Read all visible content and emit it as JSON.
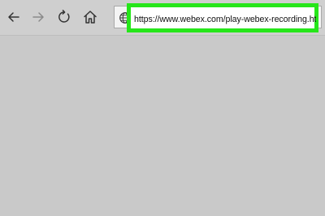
{
  "toolbar": {
    "back": {
      "icon": "back-arrow-icon",
      "enabled": true
    },
    "forward": {
      "icon": "forward-arrow-icon",
      "enabled": false
    },
    "refresh": {
      "icon": "refresh-icon"
    },
    "home": {
      "icon": "home-icon"
    }
  },
  "address_bar": {
    "site_icon": "globe-icon",
    "url": "https://www.webex.com/play-webex-recording.html",
    "highlight_color": "#26e61a"
  },
  "colors": {
    "background": "#c9c9c9",
    "toolbar": "#cfcfcf",
    "icon": "#333333",
    "icon_disabled": "#8a8a8a"
  }
}
